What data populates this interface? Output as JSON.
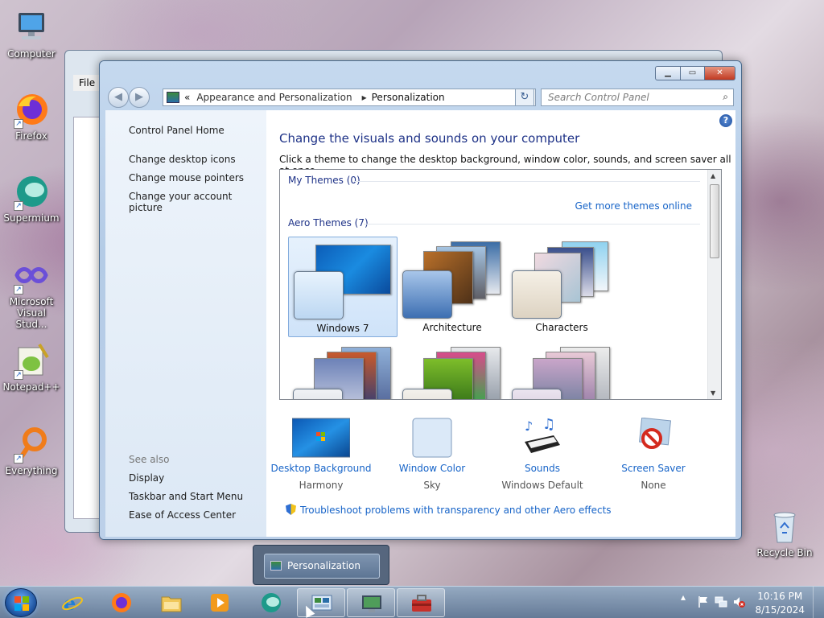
{
  "desktop": {
    "icons": [
      {
        "label": "Computer"
      },
      {
        "label": "Firefox"
      },
      {
        "label": "Supermium"
      },
      {
        "label": "Microsoft Visual Stud..."
      },
      {
        "label": "Notepad++"
      },
      {
        "label": "Everything"
      },
      {
        "label": "Recycle Bin"
      }
    ]
  },
  "background_window": {
    "menu_file": "File"
  },
  "window": {
    "caption": {
      "minimize": "▁",
      "maximize": "▭",
      "close": "✕"
    },
    "nav": {
      "back": "◀",
      "forward": "▶"
    },
    "address": {
      "prefix": "«",
      "crumbs": [
        "Appearance and Personalization",
        "Personalization"
      ],
      "separator": "▸",
      "dropdown": "▾",
      "refresh": "↻"
    },
    "search": {
      "placeholder": "Search Control Panel",
      "icon": "⌕"
    },
    "left_pane": {
      "links": [
        "Control Panel Home",
        "Change desktop icons",
        "Change mouse pointers",
        "Change your account picture"
      ],
      "see_also_title": "See also",
      "see_also": [
        "Display",
        "Taskbar and Start Menu",
        "Ease of Access Center"
      ]
    },
    "content": {
      "help": "?",
      "title": "Change the visuals and sounds on your computer",
      "subtitle": "Click a theme to change the desktop background, window color, sounds, and screen saver all at once.",
      "my_themes": "My Themes (0)",
      "get_more": "Get more themes online",
      "aero_themes": "Aero Themes (7)",
      "themes": [
        {
          "name": "Windows 7",
          "selected": true
        },
        {
          "name": "Architecture",
          "selected": false
        },
        {
          "name": "Characters",
          "selected": false
        },
        {
          "name": "",
          "selected": false
        },
        {
          "name": "",
          "selected": false
        },
        {
          "name": "",
          "selected": false
        }
      ],
      "bottom": [
        {
          "label": "Desktop Background",
          "value": "Harmony"
        },
        {
          "label": "Window Color",
          "value": "Sky"
        },
        {
          "label": "Sounds",
          "value": "Windows Default"
        },
        {
          "label": "Screen Saver",
          "value": "None"
        }
      ],
      "troubleshoot": "Troubleshoot problems with transparency and other Aero effects"
    }
  },
  "taskbar": {
    "thumbnail_label": "Personalization",
    "clock_time": "10:16 PM",
    "clock_date": "8/15/2024",
    "tray_up": "▴"
  }
}
